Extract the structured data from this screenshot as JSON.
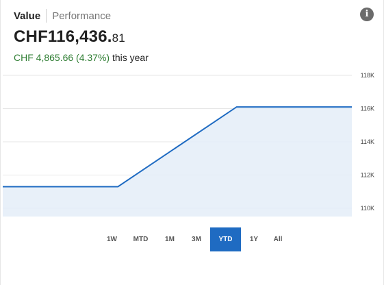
{
  "header": {
    "tab_value": "Value",
    "tab_performance": "Performance",
    "info_icon": "info-icon"
  },
  "summary": {
    "value_main": "CHF116,436.",
    "value_decimals": "81",
    "change_amount": "CHF 4,865.66 (4.37%)",
    "change_period": "this year",
    "positive_color": "#2e7d32"
  },
  "ranges": {
    "items": [
      "1W",
      "MTD",
      "1M",
      "3M",
      "YTD",
      "1Y",
      "All"
    ],
    "active": "YTD",
    "active_color": "#1f6bc2"
  },
  "chart_data": {
    "type": "area",
    "y_ticks": [
      "118K",
      "116K",
      "114K",
      "112K",
      "110K"
    ],
    "ylim": [
      109500,
      118000
    ],
    "grid": true,
    "line_color": "#1f6bc2",
    "fill_color": "#e4edf8",
    "series": [
      {
        "x": [
          0,
          0.33,
          0.67,
          1
        ],
        "y": [
          111300,
          111300,
          116100,
          116100
        ]
      }
    ]
  }
}
